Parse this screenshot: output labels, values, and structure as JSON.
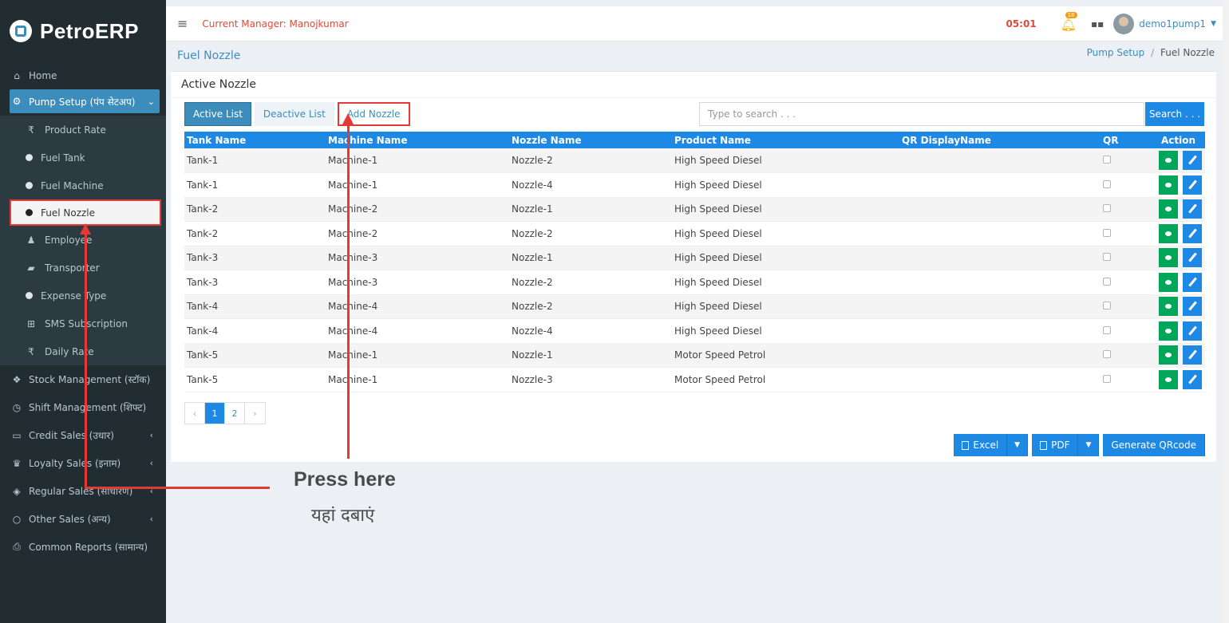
{
  "brand": {
    "name": "PetroERP"
  },
  "topbar": {
    "manager": "Current Manager: Manojkumar",
    "timer": "05:01",
    "notification_count": "18",
    "user": "demo1pump1"
  },
  "sidebar": {
    "home": "Home",
    "pump_setup": "Pump Setup (पंप सेटअप)",
    "sub": [
      {
        "label": "Product Rate",
        "icon": "rupee-icon"
      },
      {
        "label": "Fuel Tank",
        "icon": "dot-icon"
      },
      {
        "label": "Fuel Machine",
        "icon": "dot-icon"
      },
      {
        "label": "Fuel Nozzle",
        "icon": "dot-icon"
      },
      {
        "label": "Employee",
        "icon": "user-icon"
      },
      {
        "label": "Transporter",
        "icon": "truck-icon"
      },
      {
        "label": "Expense Type",
        "icon": "dot-icon"
      },
      {
        "label": "SMS Subscription",
        "icon": "plus-square-icon"
      },
      {
        "label": "Daily Rate",
        "icon": "rupee-icon"
      }
    ],
    "main": [
      {
        "label": "Stock Management (स्टॉक)",
        "icon": "cubes-icon"
      },
      {
        "label": "Shift Management (शिफ्ट)",
        "icon": "clock-icon"
      },
      {
        "label": "Credit Sales (उधार)",
        "icon": "card-icon"
      },
      {
        "label": "Loyalty Sales (इनाम)",
        "icon": "trophy-icon"
      },
      {
        "label": "Regular Sales (साधारण)",
        "icon": "cube-icon"
      },
      {
        "label": "Other Sales (अन्य)",
        "icon": "circle-icon"
      },
      {
        "label": "Common Reports (सामान्य)",
        "icon": "print-icon"
      }
    ]
  },
  "page": {
    "title": "Fuel Nozzle",
    "breadcrumb_parent": "Pump Setup",
    "breadcrumb_sep": "/",
    "breadcrumb_current": "Fuel Nozzle",
    "box_title": "Active Nozzle"
  },
  "tabs": {
    "active": "Active List",
    "deactive": "Deactive List",
    "add": "Add Nozzle"
  },
  "search": {
    "placeholder": "Type to search . . .",
    "button": "Search . . ."
  },
  "table": {
    "headers": [
      "Tank Name",
      "Machine Name",
      "Nozzle Name",
      "Product Name",
      "QR DisplayName",
      "QR",
      "Action"
    ],
    "rows": [
      [
        "Tank-1",
        "Machine-1",
        "Nozzle-2",
        "High Speed Diesel",
        ""
      ],
      [
        "Tank-1",
        "Machine-1",
        "Nozzle-4",
        "High Speed Diesel",
        ""
      ],
      [
        "Tank-2",
        "Machine-2",
        "Nozzle-1",
        "High Speed Diesel",
        ""
      ],
      [
        "Tank-2",
        "Machine-2",
        "Nozzle-2",
        "High Speed Diesel",
        ""
      ],
      [
        "Tank-3",
        "Machine-3",
        "Nozzle-1",
        "High Speed Diesel",
        ""
      ],
      [
        "Tank-3",
        "Machine-3",
        "Nozzle-2",
        "High Speed Diesel",
        ""
      ],
      [
        "Tank-4",
        "Machine-4",
        "Nozzle-2",
        "High Speed Diesel",
        ""
      ],
      [
        "Tank-4",
        "Machine-4",
        "Nozzle-4",
        "High Speed Diesel",
        ""
      ],
      [
        "Tank-5",
        "Machine-1",
        "Nozzle-1",
        "Motor Speed Petrol",
        ""
      ],
      [
        "Tank-5",
        "Machine-1",
        "Nozzle-3",
        "Motor Speed Petrol",
        ""
      ]
    ]
  },
  "pager": {
    "prev": "‹",
    "p1": "1",
    "p2": "2",
    "next": "›"
  },
  "export": {
    "excel": "Excel",
    "pdf": "PDF",
    "qr": "Generate QRcode"
  },
  "annotation": {
    "english": "Press here",
    "hindi": "यहां दबाएं"
  },
  "colors": {
    "primary": "#1e88e5",
    "sidebar": "#222d32",
    "annotation": "#e53935",
    "view": "#00a65a"
  }
}
